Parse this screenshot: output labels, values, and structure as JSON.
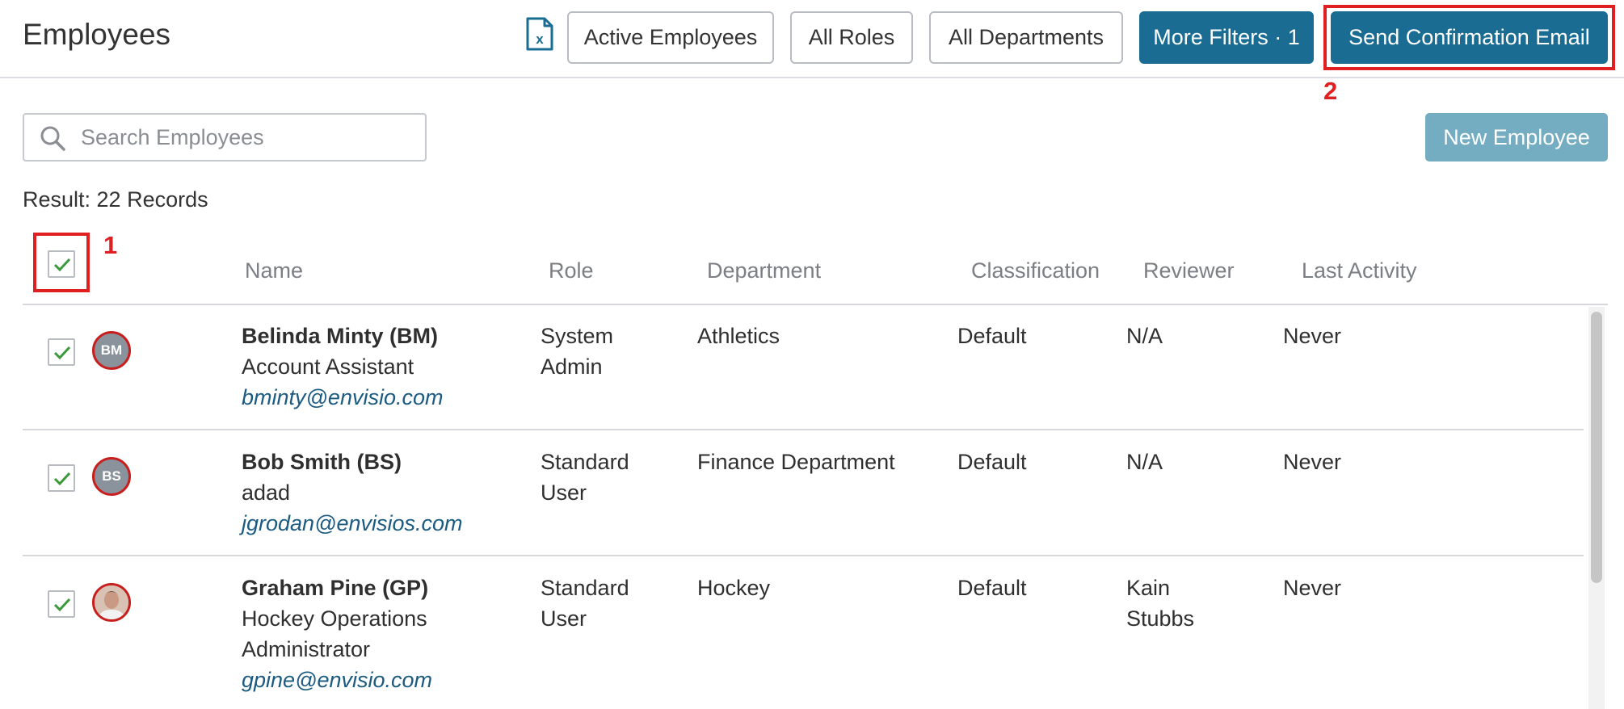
{
  "header": {
    "title": "Employees",
    "excel_icon": "excel-export-icon",
    "filters": {
      "status": "Active Employees",
      "roles": "All Roles",
      "departments": "All Departments",
      "more": "More Filters · 1"
    },
    "send_confirmation": "Send Confirmation Email"
  },
  "toolbar": {
    "search_placeholder": "Search Employees",
    "new_employee": "New Employee",
    "result": "Result: 22 Records"
  },
  "annotations": {
    "one": "1",
    "two": "2"
  },
  "table": {
    "columns": [
      "Name",
      "Role",
      "Department",
      "Classification",
      "Reviewer",
      "Last Activity"
    ],
    "rows": [
      {
        "checked": true,
        "initials": "BM",
        "name": "Belinda Minty (BM)",
        "title": [
          "Account Assistant"
        ],
        "email": "bminty@envisio.com",
        "role": [
          "System",
          "Admin"
        ],
        "department": "Athletics",
        "classification": "Default",
        "reviewer": [
          "N/A"
        ],
        "last_activity": "Never"
      },
      {
        "checked": true,
        "initials": "BS",
        "name": "Bob Smith (BS)",
        "title": [
          "adad"
        ],
        "email": "jgrodan@envisios.com",
        "role": [
          "Standard",
          "User"
        ],
        "department": "Finance Department",
        "classification": "Default",
        "reviewer": [
          "N/A"
        ],
        "last_activity": "Never"
      },
      {
        "checked": true,
        "initials": "",
        "name": "Graham Pine (GP)",
        "title": [
          "Hockey Operations",
          "Administrator"
        ],
        "email": "gpine@envisio.com",
        "role": [
          "Standard",
          "User"
        ],
        "department": "Hockey",
        "classification": "Default",
        "reviewer": [
          "Kain",
          "Stubbs"
        ],
        "last_activity": "Never"
      }
    ]
  },
  "colors": {
    "primary": "#1a6c93",
    "primary_light": "#74acc2",
    "annotation": "#e02020",
    "check": "#3a9a3a",
    "email_link": "#1b5b82"
  }
}
